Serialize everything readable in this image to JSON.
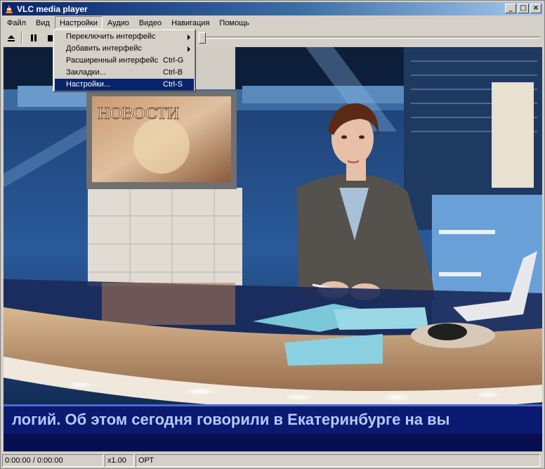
{
  "window": {
    "title": "VLC media player",
    "buttons": {
      "minimize": "_",
      "maximize": "□",
      "close": "×"
    }
  },
  "menubar": {
    "items": [
      "Файл",
      "Вид",
      "Настройки",
      "Аудио",
      "Видео",
      "Навигация",
      "Помощь"
    ],
    "active_index": 2
  },
  "dropdown": {
    "items": [
      {
        "label": "Переключить интерфейс",
        "shortcut": "",
        "submenu": true
      },
      {
        "label": "Добавить интерфейс",
        "shortcut": "",
        "submenu": true
      },
      {
        "label": "Расширенный интерфейс",
        "shortcut": "Ctrl-G",
        "submenu": false
      },
      {
        "label": "Закладки...",
        "shortcut": "Ctrl-B",
        "submenu": false
      },
      {
        "label": "Настройки...",
        "shortcut": "Ctrl-S",
        "submenu": false
      }
    ],
    "selected_index": 4
  },
  "toolbar": {
    "icons": [
      "eject-icon",
      "pause-icon",
      "stop-icon"
    ]
  },
  "video": {
    "screen_text": "НОВОСТИ",
    "ticker_text": "логий. Об этом сегодня говорили в Екатеринбурге на вы"
  },
  "statusbar": {
    "time": "0:00:00 / 0:00:00",
    "speed": "x1.00",
    "program": "ОРТ"
  },
  "colors": {
    "titlebar_start": "#0a246a",
    "titlebar_end": "#a6caf0",
    "menu_highlight": "#0a246a",
    "ticker_bg": "#0a1a70",
    "ticker_text": "#b8c8ff"
  }
}
